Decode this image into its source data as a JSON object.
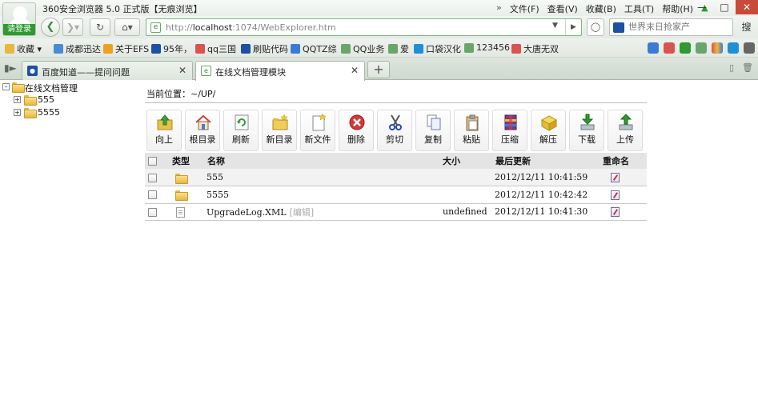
{
  "browser": {
    "title": "360安全浏览器 5.0 正式版【无痕浏览】",
    "login_label": "请登录",
    "menus": [
      "文件(F)",
      "查看(V)",
      "收藏(B)",
      "工具(T)",
      "帮助(H)"
    ],
    "menu_overflow": "»",
    "url_prefix": "http://",
    "url_host": "localhost",
    "url_rest": ":1074/WebExplorer.htm",
    "search_placeholder": "世界末日抢家产",
    "search_button": "搜",
    "accent_color": "#2f9a2f"
  },
  "bookmarks": [
    {
      "label": "收藏",
      "color": "#e8b83e",
      "dropdown": true
    },
    {
      "label": "成都迅达",
      "color": "#4a8bd4"
    },
    {
      "label": "关于EFS",
      "color": "#f0a020"
    },
    {
      "label": "95年，",
      "color": "#1d4fa3"
    },
    {
      "label": "qq三国",
      "color": "#d9534f"
    },
    {
      "label": "刷贴代码",
      "color": "#1d4fa3"
    },
    {
      "label": "QQTZ综",
      "color": "#3a7bd5"
    },
    {
      "label": "QQ业务",
      "color": "#6ba56b"
    },
    {
      "label": "爱",
      "color": "#6ba56b"
    },
    {
      "label": "口袋汉化",
      "color": "#1f8fd8"
    },
    {
      "label": "123456",
      "color": "#6ba56b"
    },
    {
      "label": "大唐无双",
      "color": "#d9534f"
    }
  ],
  "tabs": [
    {
      "label": "百度知道——提问问题",
      "active": false
    },
    {
      "label": "在线文档管理模块",
      "active": true
    }
  ],
  "tree": {
    "root": "在线文档管理",
    "children": [
      "555",
      "5555"
    ]
  },
  "location": {
    "label": "当前位置：",
    "path": "~/UP/"
  },
  "toolbar": [
    {
      "label": "向上",
      "icon": "folder-up-icon"
    },
    {
      "label": "根目录",
      "icon": "home-icon"
    },
    {
      "label": "刷新",
      "icon": "refresh-icon"
    },
    {
      "label": "新目录",
      "icon": "new-folder-icon"
    },
    {
      "label": "新文件",
      "icon": "new-file-icon"
    },
    {
      "label": "删除",
      "icon": "delete-icon"
    },
    {
      "label": "剪切",
      "icon": "scissors-icon"
    },
    {
      "label": "复制",
      "icon": "copy-icon"
    },
    {
      "label": "粘贴",
      "icon": "paste-icon"
    },
    {
      "label": "压缩",
      "icon": "archive-icon"
    },
    {
      "label": "解压",
      "icon": "extract-icon"
    },
    {
      "label": "下载",
      "icon": "download-icon"
    },
    {
      "label": "上传",
      "icon": "upload-icon"
    }
  ],
  "table": {
    "headers": {
      "type": "类型",
      "name": "名称",
      "size": "大小",
      "updated": "最后更新",
      "rename": "重命名"
    },
    "rows": [
      {
        "type": "folder",
        "name": "555",
        "edit": "",
        "size": "",
        "updated": "2012/12/11 10:41:59"
      },
      {
        "type": "folder",
        "name": "5555",
        "edit": "",
        "size": "",
        "updated": "2012/12/11 10:42:42"
      },
      {
        "type": "file",
        "name": "UpgradeLog.XML",
        "edit": "[编辑]",
        "size": "undefined",
        "updated": "2012/12/11 10:41:30"
      }
    ]
  }
}
